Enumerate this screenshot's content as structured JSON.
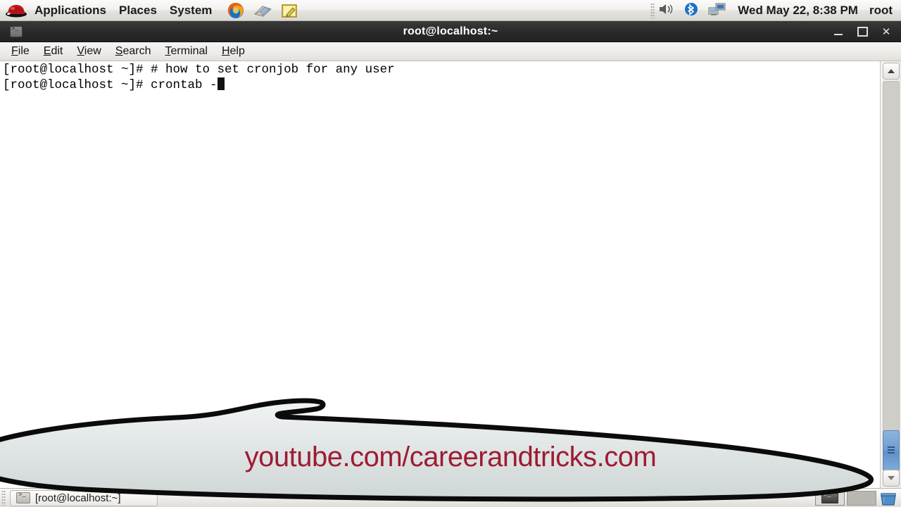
{
  "desktop": {
    "top_panel": {
      "logo": "redhat-logo",
      "menus": [
        {
          "label": "Applications",
          "name": "menu-applications"
        },
        {
          "label": "Places",
          "name": "menu-places"
        },
        {
          "label": "System",
          "name": "menu-system"
        }
      ],
      "launchers": [
        {
          "name": "firefox-icon",
          "title": "Firefox Web Browser"
        },
        {
          "name": "evolution-mail-icon",
          "title": "Evolution Mail"
        },
        {
          "name": "text-editor-icon",
          "title": "Text Editor"
        }
      ],
      "tray": [
        {
          "name": "volume-icon"
        },
        {
          "name": "bluetooth-icon"
        },
        {
          "name": "network-icon"
        }
      ],
      "clock": "Wed May 22,  8:38 PM",
      "user": "root"
    },
    "bottom_panel": {
      "task_button_label": "[root@localhost:~]",
      "task_button_icon": "terminal-icon",
      "workspaces": [
        {
          "name": "workspace-1",
          "active": true
        },
        {
          "name": "workspace-2",
          "active": false
        }
      ],
      "trash_icon": "trash-icon"
    }
  },
  "terminal": {
    "title": "root@localhost:~",
    "window_controls": {
      "minimize": "–",
      "maximize": "□",
      "close": "✕"
    },
    "menubar": [
      {
        "name": "menu-file",
        "mnemonic": "F",
        "rest": "ile"
      },
      {
        "name": "menu-edit",
        "mnemonic": "E",
        "rest": "dit"
      },
      {
        "name": "menu-view",
        "mnemonic": "V",
        "rest": "iew"
      },
      {
        "name": "menu-search",
        "mnemonic": "S",
        "rest": "earch"
      },
      {
        "name": "menu-terminal",
        "mnemonic": "T",
        "rest": "erminal"
      },
      {
        "name": "menu-help",
        "mnemonic": "H",
        "rest": "elp"
      }
    ],
    "lines": [
      "[root@localhost ~]# # how to set cronjob for any user",
      "[root@localhost ~]# crontab -"
    ],
    "line1": "[root@localhost ~]# # how to set cronjob for any user",
    "line2": "[root@localhost ~]# crontab -",
    "cursor": "block",
    "colors": {
      "background": "#ffffff",
      "foreground": "#000000"
    },
    "scrollbar": {
      "up_arrow": "scroll-up-icon",
      "down_arrow": "scroll-down-icon",
      "thumb_position": "bottom"
    }
  },
  "watermark": {
    "text": "youtube.com/careerandtricks.com",
    "color": "#9e1b34"
  }
}
